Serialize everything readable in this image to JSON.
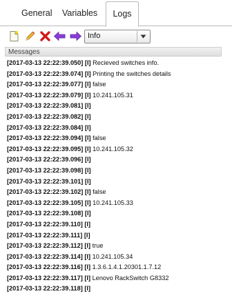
{
  "tabs": [
    {
      "label": "General"
    },
    {
      "label": "Variables"
    },
    {
      "label": "Logs"
    }
  ],
  "toolbar": {
    "icons": [
      "new-document-icon",
      "pencil-icon",
      "delete-x-icon",
      "back-arrow-icon",
      "forward-arrow-icon"
    ],
    "level_select": {
      "value": "Info"
    }
  },
  "messages": {
    "header": "Messages",
    "lines": [
      {
        "ts": "[2017-03-13 22:22:39.050] [I]",
        "text": " Recieved switches info."
      },
      {
        "ts": "[2017-03-13 22:22:39.074] [I]",
        "text": " Printing the switches details"
      },
      {
        "ts": "[2017-03-13 22:22:39.077] [I]",
        "text": " false"
      },
      {
        "ts": "[2017-03-13 22:22:39.079] [I]",
        "text": " 10.241.105.31"
      },
      {
        "ts": "[2017-03-13 22:22:39.081] [I]",
        "text": ""
      },
      {
        "ts": "[2017-03-13 22:22:39.082] [I]",
        "text": ""
      },
      {
        "ts": "[2017-03-13 22:22:39.084] [I]",
        "text": ""
      },
      {
        "ts": "[2017-03-13 22:22:39.094] [I]",
        "text": " false"
      },
      {
        "ts": "[2017-03-13 22:22:39.095] [I]",
        "text": " 10.241.105.32"
      },
      {
        "ts": "[2017-03-13 22:22:39.096] [I]",
        "text": ""
      },
      {
        "ts": "[2017-03-13 22:22:39.098] [I]",
        "text": ""
      },
      {
        "ts": "[2017-03-13 22:22:39.101] [I]",
        "text": ""
      },
      {
        "ts": "[2017-03-13 22:22:39.102] [I]",
        "text": " false"
      },
      {
        "ts": "[2017-03-13 22:22:39.105] [I]",
        "text": " 10.241.105.33"
      },
      {
        "ts": "[2017-03-13 22:22:39.108] [I]",
        "text": ""
      },
      {
        "ts": "[2017-03-13 22:22:39.110] [I]",
        "text": ""
      },
      {
        "ts": "[2017-03-13 22:22:39.111] [I]",
        "text": ""
      },
      {
        "ts": "[2017-03-13 22:22:39.112] [I]",
        "text": " true"
      },
      {
        "ts": "[2017-03-13 22:22:39.114] [I]",
        "text": " 10.241.105.34"
      },
      {
        "ts": "[2017-03-13 22:22:39.116] [I]",
        "text": " 1.3.6.1.4.1.20301.1.7.12"
      },
      {
        "ts": "[2017-03-13 22:22:39.117] [I]",
        "text": " Lenovo RackSwitch G8332"
      },
      {
        "ts": "[2017-03-13 22:22:39.118] [I]",
        "text": ""
      }
    ]
  }
}
